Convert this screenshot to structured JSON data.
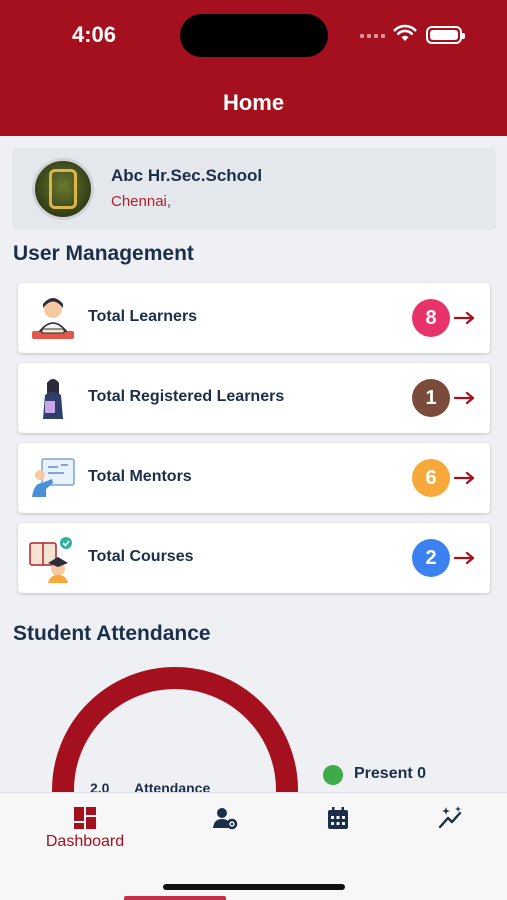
{
  "status_bar": {
    "time": "4:06"
  },
  "header": {
    "title": "Home"
  },
  "school": {
    "name": "Abc Hr.Sec.School",
    "city": "Chennai,"
  },
  "user_management": {
    "title": "User Management",
    "items": [
      {
        "label": "Total Learners",
        "count": "8",
        "badge_color": "#e8336a",
        "icon": "learner-icon"
      },
      {
        "label": "Total Registered Learners",
        "count": "1",
        "badge_color": "#7a4b3a",
        "icon": "registered-learner-icon"
      },
      {
        "label": "Total Mentors",
        "count": "6",
        "badge_color": "#f6a83a",
        "icon": "mentor-icon"
      },
      {
        "label": "Total Courses",
        "count": "2",
        "badge_color": "#3b82f0",
        "icon": "course-icon"
      }
    ]
  },
  "attendance": {
    "title": "Student Attendance",
    "center_value": "2.0",
    "center_label": "Attendance",
    "legend": [
      {
        "label": "Present 0",
        "color": "#3faa4a"
      }
    ]
  },
  "tabbar": {
    "tabs": [
      {
        "label": "Dashboard",
        "icon": "dashboard-icon",
        "active": true
      },
      {
        "label": "",
        "icon": "user-settings-icon",
        "active": false
      },
      {
        "label": "",
        "icon": "calendar-icon",
        "active": false
      },
      {
        "label": "",
        "icon": "sparkle-chart-icon",
        "active": false
      }
    ]
  },
  "colors": {
    "brand": "#a5101e",
    "text": "#1c2f4a",
    "accent_text": "#b3202c"
  }
}
